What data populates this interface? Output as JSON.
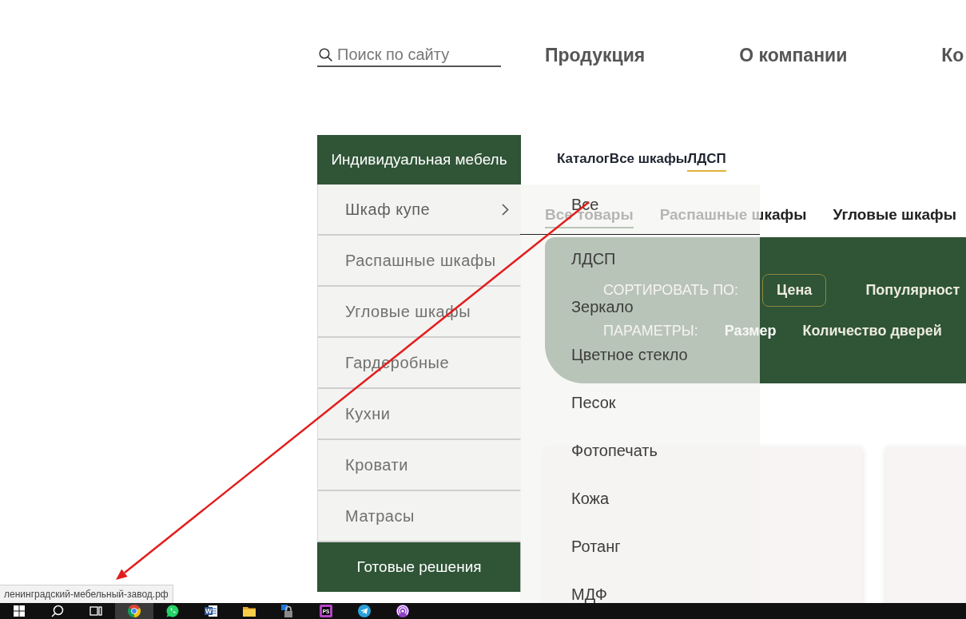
{
  "header": {
    "search": {
      "placeholder": "Поиск по сайту"
    },
    "nav": [
      {
        "label": "Продукция"
      },
      {
        "label": "О компании"
      },
      {
        "label": "Ко"
      }
    ]
  },
  "sidebar": {
    "sections": [
      {
        "title": "Индивидуальная мебель",
        "items": [
          {
            "label": "Шкаф купе",
            "expanded": true,
            "submenu": [
              {
                "label": "Все"
              },
              {
                "label": "ЛДСП"
              },
              {
                "label": "Зеркало"
              },
              {
                "label": "Цветное стекло"
              },
              {
                "label": "Песок"
              },
              {
                "label": "Фотопечать"
              },
              {
                "label": "Кожа"
              },
              {
                "label": "Ротанг"
              },
              {
                "label": "МДФ"
              }
            ]
          },
          {
            "label": "Распашные шкафы",
            "expanded": false
          },
          {
            "label": "Угловые шкафы",
            "expanded": false
          },
          {
            "label": "Гардеробные",
            "expanded": false
          },
          {
            "label": "Кухни",
            "expanded": false
          },
          {
            "label": "Кровати",
            "expanded": false
          },
          {
            "label": "Матрасы",
            "expanded": false
          }
        ]
      },
      {
        "title": "Готовые решения"
      }
    ]
  },
  "breadcrumb": [
    {
      "label": "Каталог",
      "current": false
    },
    {
      "label": "Все шкафы",
      "current": false
    },
    {
      "label": "ЛДСП",
      "current": true
    }
  ],
  "tabs": [
    {
      "label": "Все товары",
      "selected": true
    },
    {
      "label": "Распашные шкафы",
      "selected": false
    },
    {
      "label": "Угловые шкафы",
      "selected": false
    }
  ],
  "filters": {
    "sort": {
      "label": "СОРТИРОВАТЬ ПО:",
      "options": [
        {
          "label": "Цена",
          "selected": true
        },
        {
          "label": "Популярност",
          "selected": false
        }
      ]
    },
    "params": {
      "label": "ПАРАМЕТРЫ:",
      "options": [
        {
          "label": "Размер"
        },
        {
          "label": "Количество дверей"
        }
      ]
    }
  },
  "status_url": "ленинградский-мебельный-завод.рф",
  "taskbar": {
    "items": [
      {
        "kind": "start",
        "selected": false
      },
      {
        "kind": "search",
        "selected": false
      },
      {
        "kind": "task-view",
        "selected": false
      },
      {
        "kind": "browser",
        "selected": true
      },
      {
        "kind": "chat",
        "selected": false
      },
      {
        "kind": "word",
        "label": "W",
        "selected": false
      },
      {
        "kind": "folder",
        "selected": false
      },
      {
        "kind": "lock",
        "selected": false
      },
      {
        "kind": "ide",
        "label": "PS",
        "selected": false
      },
      {
        "kind": "telegram",
        "selected": false
      },
      {
        "kind": "podcast",
        "selected": false
      }
    ]
  }
}
